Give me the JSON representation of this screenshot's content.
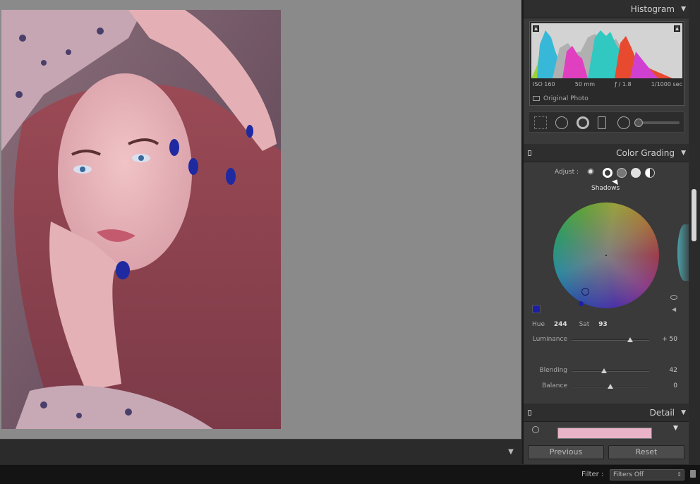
{
  "histogram": {
    "title": "Histogram",
    "iso": "ISO 160",
    "focal": "50 mm",
    "aperture": "ƒ / 1.8",
    "shutter": "1/1000 sec",
    "original_photo": "Original Photo"
  },
  "color_grading": {
    "title": "Color Grading",
    "adjust_label": "Adjust :",
    "mode_caption": "Shadows",
    "hue_label": "Hue",
    "hue_value": "244",
    "sat_label": "Sat",
    "sat_value": "93",
    "swatch_color": "#1b1fa3",
    "luminance": {
      "label": "Luminance",
      "value": "+ 50",
      "position": 0.75
    },
    "blending": {
      "label": "Blending",
      "value": "42",
      "position": 0.42
    },
    "balance": {
      "label": "Balance",
      "value": "0",
      "position": 0.5
    }
  },
  "detail": {
    "title": "Detail"
  },
  "buttons": {
    "previous": "Previous",
    "reset": "Reset"
  },
  "filter": {
    "label": "Filter :",
    "value": "Filters Off"
  }
}
